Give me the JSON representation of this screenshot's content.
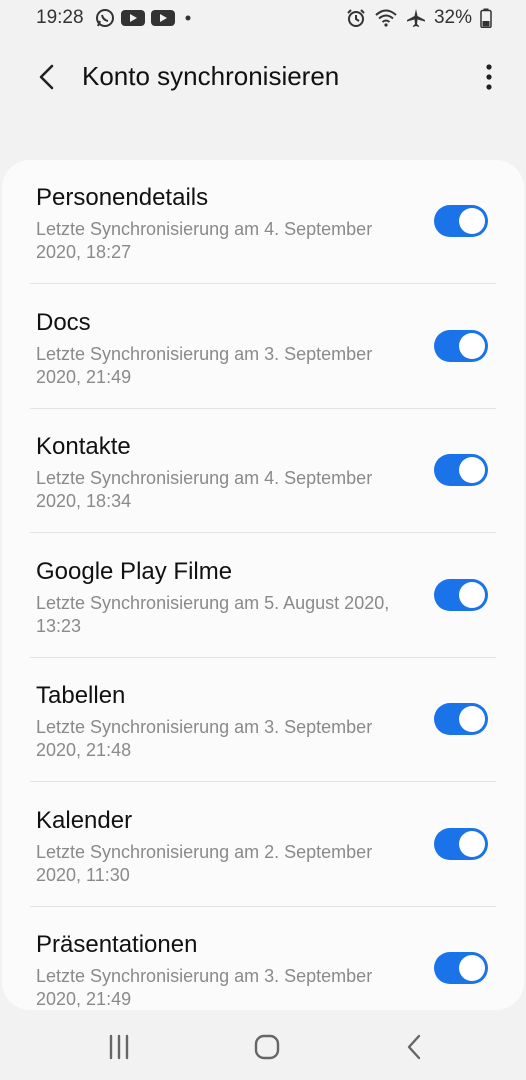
{
  "status_bar": {
    "time": "19:28",
    "battery": "32%",
    "left_icons": [
      "whatsapp-icon",
      "youtube-icon",
      "youtube-icon",
      "notification-dot-icon"
    ],
    "right_icons": [
      "alarm-icon",
      "wifi-icon",
      "airplane-mode-icon",
      "battery-icon"
    ]
  },
  "header": {
    "title": "Konto synchronisieren",
    "back_icon": "back-arrow-icon",
    "more_icon": "more-vert-icon"
  },
  "sync_items": [
    {
      "title": "Personendetails",
      "subtitle": "Letzte Synchronisierung am 4. September 2020, 18:27",
      "enabled": true
    },
    {
      "title": "Docs",
      "subtitle": "Letzte Synchronisierung am 3. September 2020, 21:49",
      "enabled": true
    },
    {
      "title": "Kontakte",
      "subtitle": "Letzte Synchronisierung am 4. September 2020, 18:34",
      "enabled": true
    },
    {
      "title": "Google Play Filme",
      "subtitle": "Letzte Synchronisierung am 5. August 2020, 13:23",
      "enabled": true
    },
    {
      "title": "Tabellen",
      "subtitle": "Letzte Synchronisierung am 3. September 2020, 21:48",
      "enabled": true
    },
    {
      "title": "Kalender",
      "subtitle": "Letzte Synchronisierung am 2. September 2020, 11:30",
      "enabled": true
    },
    {
      "title": "Präsentationen",
      "subtitle": "Letzte Synchronisierung am 3. September 2020, 21:49",
      "enabled": true
    }
  ],
  "colors": {
    "accent": "#1a73e8",
    "background": "#f2f2f2",
    "card": "#fbfbfb",
    "secondary_text": "#8a8a8a"
  },
  "nav_bar": {
    "icons": [
      "recent-apps-icon",
      "home-icon",
      "back-icon"
    ]
  }
}
